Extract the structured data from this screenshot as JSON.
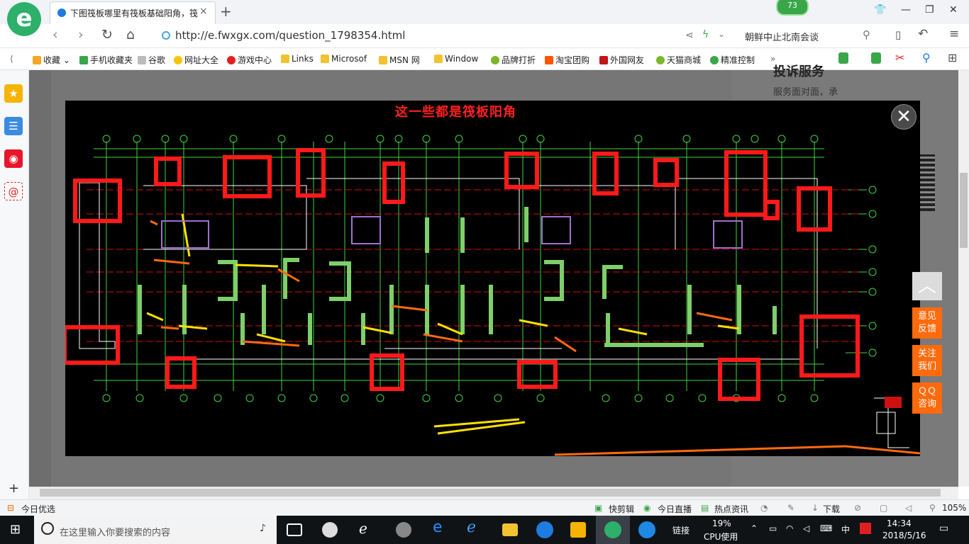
{
  "browser": {
    "tab_title": "下图筏板哪里有筏板基础阳角，筏",
    "tab_close": "×",
    "new_tab": "+",
    "notification_count": "73",
    "url": "http://e.fwxgx.com/question_1798354.html",
    "search_suggestion": "朝鲜中止北南会谈",
    "window_controls": {
      "skin": "👕",
      "minimize": "—",
      "maximize": "❐",
      "close": "✕"
    }
  },
  "bookmarks": [
    {
      "label": "收藏",
      "icon_color": "#f5a623"
    },
    {
      "label": "手机收藏夹",
      "icon_color": "#3aa64a"
    },
    {
      "label": "谷歌",
      "icon_color": "#bbbbbb"
    },
    {
      "label": "网址大全",
      "icon_color": "#f5c400"
    },
    {
      "label": "游戏中心",
      "icon_color": "#e02020"
    },
    {
      "label": "Links",
      "icon_color": "#f2c230"
    },
    {
      "label": "Microsof",
      "icon_color": "#f2c230"
    },
    {
      "label": "MSN 网",
      "icon_color": "#f2c230"
    },
    {
      "label": "Window",
      "icon_color": "#f2c230"
    },
    {
      "label": "品牌打折",
      "icon_color": "#7ab829"
    },
    {
      "label": "淘宝团购",
      "icon_color": "#ff5500"
    },
    {
      "label": "外国网友",
      "icon_color": "#c0151b"
    },
    {
      "label": "天猫商城",
      "icon_color": "#7ab829"
    },
    {
      "label": "精准控制",
      "icon_color": "#3aa64a"
    },
    {
      "label": "»",
      "icon_color": ""
    }
  ],
  "page": {
    "right_heading": "投诉服务",
    "right_text": "服务面对面，承"
  },
  "viewer": {
    "caption": "这一些都是筏板阳角",
    "close": "✕"
  },
  "float_buttons": {
    "to_top": "︿",
    "feedback": "意见\n反馈",
    "follow": "关注\n我们",
    "qq": "ＱＱ\n咨询"
  },
  "statusbar": {
    "left": "今日优选",
    "items": [
      "快剪辑",
      "今日直播",
      "热点资讯"
    ],
    "download": "下载",
    "zoom": "105%"
  },
  "taskbar": {
    "search_placeholder": "在这里输入你要搜索的内容",
    "link": "链接",
    "cpu_percent": "19%",
    "cpu_label": "CPU使用",
    "ime": "中",
    "time": "14:34",
    "date": "2018/5/16"
  },
  "colors": {
    "accent_green": "#2db06a",
    "annotation_red": "#ff1a1a",
    "float_orange": "#ff6a0c"
  }
}
